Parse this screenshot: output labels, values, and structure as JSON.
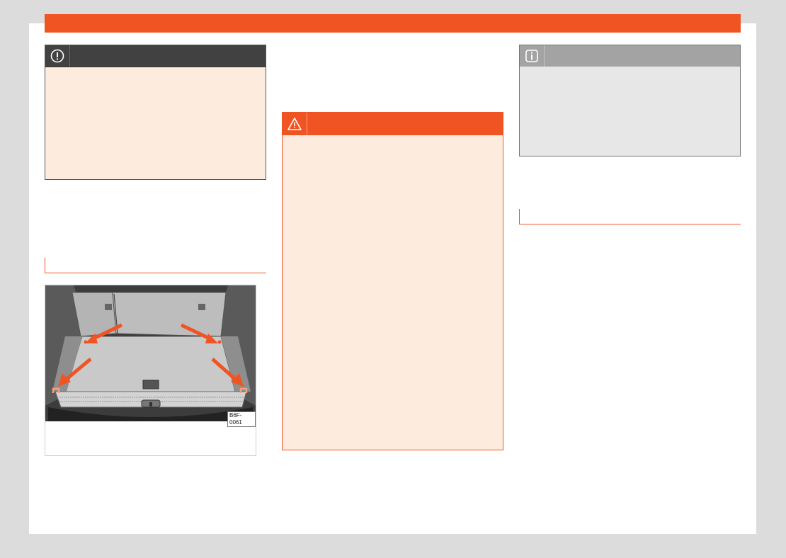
{
  "figure": {
    "code": "B6F-0061"
  },
  "colors": {
    "accent": "#f15423",
    "notice_bg": "#fdebde",
    "notice_head": "#414141",
    "note_bg": "#e7e7e7",
    "note_head": "#a3a3a3"
  },
  "icons": {
    "notice": "exclamation-circle-icon",
    "warning": "warning-triangle-icon",
    "note": "info-icon"
  }
}
